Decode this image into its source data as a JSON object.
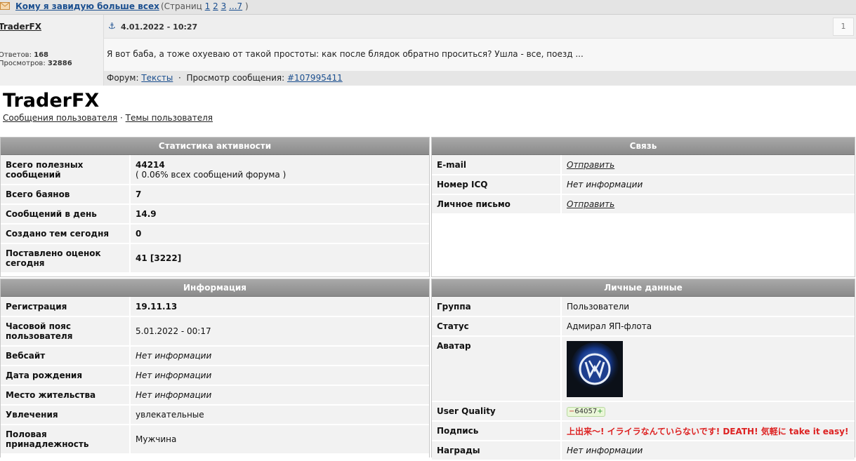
{
  "topic": {
    "title": "Кому я завидую больше всех",
    "pages_open": "(Страниц ",
    "pages": [
      "1",
      "2",
      "3",
      "...7"
    ],
    "pages_close": ")"
  },
  "post": {
    "author": "TraderFX",
    "replies_label": "Ответов:",
    "replies_value": "168",
    "views_label": "Просмотров:",
    "views_value": "32886",
    "anchor_icon": "anchor-icon",
    "date": "4.01.2022 - 10:27",
    "number": "1",
    "text": "Я вот баба, а тоже охуеваю от такой простоты: как после блядок обратно проситься? Ушла - все, поезд ...",
    "forum_label": "Форум:",
    "forum_link": "Тексты",
    "separator": "·",
    "view_label": "Просмотр сообщения:",
    "view_link": "#107995411"
  },
  "profile": {
    "name": "TraderFX",
    "link_messages": "Сообщения пользователя",
    "link_sep": " · ",
    "link_topics": "Темы пользователя"
  },
  "stats": {
    "title": "Статистика активности",
    "rows": [
      {
        "key": "Всего полезных сообщений",
        "value": "44214",
        "sub": "( 0.06% всех сообщений форума )"
      },
      {
        "key": "Всего баянов",
        "value": "7"
      },
      {
        "key": "Сообщений в день",
        "value": "14.9"
      },
      {
        "key": "Создано тем сегодня",
        "value": "0"
      },
      {
        "key": "Поставлено оценок сегодня",
        "value": "41 [3222]"
      }
    ]
  },
  "contact": {
    "title": "Связь",
    "rows": [
      {
        "key": "E-mail",
        "value": "Отправить"
      },
      {
        "key": "Номер ICQ",
        "value": "Нет информации"
      },
      {
        "key": "Личное письмо",
        "value": "Отправить"
      }
    ]
  },
  "info": {
    "title": "Информация",
    "rows": [
      {
        "key": "Регистрация",
        "value": "19.11.13"
      },
      {
        "key": "Часовой пояс пользователя",
        "value": "5.01.2022 - 00:17"
      },
      {
        "key": "Вебсайт",
        "value": "Нет информации"
      },
      {
        "key": "Дата рождения",
        "value": "Нет информации"
      },
      {
        "key": "Место жительства",
        "value": "Нет информации"
      },
      {
        "key": "Увлечения",
        "value": "увлекательные"
      },
      {
        "key": "Половая принадлежность",
        "value": "Мужчина"
      }
    ]
  },
  "personal": {
    "title": "Личные данные",
    "rows": [
      {
        "key": "Группа",
        "value": "Пользователи"
      },
      {
        "key": "Статус",
        "value": "Адмирал ЯП-флота"
      },
      {
        "key": "Аватар",
        "avatar": "vw-logo-avatar"
      },
      {
        "key": "User Quality",
        "minus": "−",
        "value": "64057",
        "plus": "+"
      },
      {
        "key": "Подпись",
        "value": "上出来〜! イライラなんていらないです! DEATH! 気軽に take it easy!"
      },
      {
        "key": "Награды",
        "value": "Нет информации"
      }
    ]
  },
  "colors": {
    "link": "#1b4f8f",
    "panel_header": "#939393",
    "row_bg": "#f2f2f2",
    "signature": "#dd2222"
  }
}
